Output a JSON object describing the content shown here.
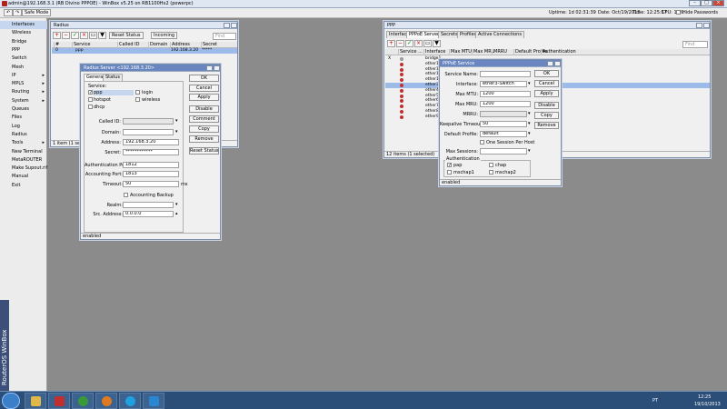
{
  "app": {
    "title": "admin@192.168.3.1 (RB Divino PPPOE) - WinBox v5.25 on RB1100Hx2 (powerpc)",
    "vertical_brand": "RouterOS WinBox"
  },
  "toolbar": {
    "undo": "↶",
    "redo": "↷",
    "safe_mode": "Safe Mode",
    "uptime": "Uptime: 1d 02:31:39",
    "date": "Date: Oct/19/2013",
    "time": "Time: 12:25:57",
    "cpu": "CPU: 16%",
    "hide_passwords": "Hide Passwords"
  },
  "sidebar": {
    "items": [
      {
        "label": "Interfaces",
        "arrow": ""
      },
      {
        "label": "Wireless",
        "arrow": ""
      },
      {
        "label": "Bridge",
        "arrow": ""
      },
      {
        "label": "PPP",
        "arrow": ""
      },
      {
        "label": "Switch",
        "arrow": ""
      },
      {
        "label": "Mesh",
        "arrow": ""
      },
      {
        "label": "IP",
        "arrow": "▸"
      },
      {
        "label": "MPLS",
        "arrow": "▸"
      },
      {
        "label": "Routing",
        "arrow": "▸"
      },
      {
        "label": "System",
        "arrow": "▸"
      },
      {
        "label": "Queues",
        "arrow": ""
      },
      {
        "label": "Files",
        "arrow": ""
      },
      {
        "label": "Log",
        "arrow": ""
      },
      {
        "label": "Radius",
        "arrow": ""
      },
      {
        "label": "Tools",
        "arrow": "▸"
      },
      {
        "label": "New Terminal",
        "arrow": ""
      },
      {
        "label": "MetaROUTER",
        "arrow": ""
      },
      {
        "label": "Make Supout.rif",
        "arrow": ""
      },
      {
        "label": "Manual",
        "arrow": ""
      },
      {
        "label": "Exit",
        "arrow": ""
      }
    ]
  },
  "radius_list": {
    "title": "Radius",
    "reset_status": "Reset Status",
    "incoming": "Incoming",
    "find": "Find",
    "columns": [
      "#",
      "Service",
      "Called ID",
      "Domain",
      "Address",
      "Secret"
    ],
    "rows": [
      {
        "num": "0",
        "service": "ppp",
        "called_id": "",
        "domain": "",
        "address": "192.168.3.20",
        "secret": "*****"
      }
    ],
    "status": "1 item (1 selected)"
  },
  "radius_server": {
    "title": "Radius Server <192.168.3.20>",
    "tabs": [
      "General",
      "Status"
    ],
    "service_label": "Service:",
    "services": [
      {
        "label": "ppp",
        "checked": true
      },
      {
        "label": "login",
        "checked": false
      },
      {
        "label": "hotspot",
        "checked": false
      },
      {
        "label": "wireless",
        "checked": false
      },
      {
        "label": "dhcp",
        "checked": false
      }
    ],
    "labels": {
      "called_id": "Called ID:",
      "domain": "Domain:",
      "address": "Address:",
      "secret": "Secret:",
      "auth_port": "Authentication Port:",
      "acct_port": "Accounting Port:",
      "timeout": "Timeout:",
      "acct_backup": "Accounting Backup",
      "realm": "Realm:",
      "src_address": "Src. Address:"
    },
    "values": {
      "address": "192.168.3.20",
      "secret": "************",
      "auth_port": "1812",
      "acct_port": "1813",
      "timeout": "50",
      "timeout_unit": "ms",
      "src_address": "0.0.0.0"
    },
    "buttons": [
      "OK",
      "Cancel",
      "Apply",
      "Disable",
      "Comment",
      "Copy",
      "Remove",
      "Reset Status"
    ],
    "status": "enabled"
  },
  "ppp": {
    "title": "PPP",
    "tabs": [
      "Interface",
      "PPPoE Servers",
      "Secrets",
      "Profiles",
      "Active Connections"
    ],
    "find": "Find",
    "columns": [
      "Service ...",
      "Interface",
      "Max MTU",
      "Max MRU",
      "MRRU",
      "Default Profile",
      "Authentication"
    ],
    "rows": [
      {
        "flag": "X",
        "service": "",
        "interface": "bridge1"
      },
      {
        "flag": "",
        "service": "",
        "interface": "ether10-"
      },
      {
        "flag": "",
        "service": "",
        "interface": "ether11-"
      },
      {
        "flag": "",
        "service": "",
        "interface": "ether12-"
      },
      {
        "flag": "",
        "service": "",
        "interface": "ether1/2"
      },
      {
        "flag": "",
        "service": "",
        "interface": "ether3-S"
      },
      {
        "flag": "",
        "service": "",
        "interface": "ether4- L"
      },
      {
        "flag": "",
        "service": "",
        "interface": "ether5-Pi"
      },
      {
        "flag": "",
        "service": "",
        "interface": "ether6-Pi"
      },
      {
        "flag": "",
        "service": "",
        "interface": "ether7-C"
      },
      {
        "flag": "",
        "service": "",
        "interface": "ether8-D"
      },
      {
        "flag": "",
        "service": "",
        "interface": "ether9-D"
      }
    ],
    "selected_row": 5,
    "status": "12 items (1 selected)"
  },
  "pppoe_service": {
    "title": "PPPoE Service",
    "labels": {
      "service_name": "Service Name:",
      "interface": "Interface:",
      "max_mtu": "Max MTU:",
      "max_mru": "Max MRU:",
      "mrru": "MRRU:",
      "keepalive": "Keepalive Timeout:",
      "default_profile": "Default Profile:",
      "one_session": "One Session Per Host",
      "max_sessions": "Max Sessions:",
      "authentication": "Authentication"
    },
    "values": {
      "service_name": "",
      "interface": "ether3-Switch",
      "max_mtu": "1200",
      "max_mru": "1200",
      "keepalive": "50",
      "default_profile": "default"
    },
    "auth": [
      {
        "label": "pap",
        "checked": true
      },
      {
        "label": "chap",
        "checked": false
      },
      {
        "label": "mschap1",
        "checked": false
      },
      {
        "label": "mschap2",
        "checked": false
      }
    ],
    "buttons": [
      "OK",
      "Cancel",
      "Apply",
      "Disable",
      "Copy",
      "Remove"
    ],
    "status": "enabled"
  },
  "taskbar": {
    "lang": "PT",
    "clock_time": "12:25",
    "clock_date": "19/10/2013"
  },
  "colors": {
    "desktop": "#8b8b8b",
    "taskbar": "#2b4e78",
    "selection": "#9dbbe8",
    "active_title": "#6a86c0"
  }
}
